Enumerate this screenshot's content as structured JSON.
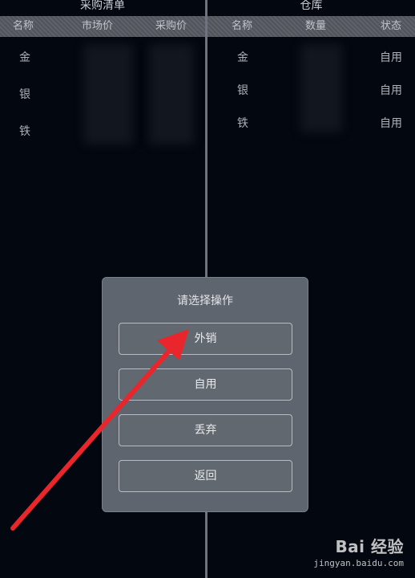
{
  "purchase_list": {
    "title": "采购清单",
    "columns": [
      "名称",
      "市场价",
      "采购价"
    ],
    "rows": [
      "金",
      "银",
      "铁"
    ]
  },
  "warehouse": {
    "title": "仓库",
    "columns": [
      "名称",
      "数量",
      "状态"
    ],
    "rows": [
      {
        "name": "金",
        "status": "自用"
      },
      {
        "name": "银",
        "status": "自用"
      },
      {
        "name": "铁",
        "status": "自用"
      }
    ]
  },
  "dialog": {
    "title": "请选择操作",
    "options": [
      "外销",
      "自用",
      "丢弃",
      "返回"
    ]
  },
  "annotation": {
    "arrow_color": "#e8262b"
  },
  "watermark": {
    "logo": "Bai  经验",
    "url": "jingyan.baidu.com"
  },
  "colors": {
    "background": "#03070f",
    "header": "#55595f",
    "dialog": "#5f656e"
  }
}
